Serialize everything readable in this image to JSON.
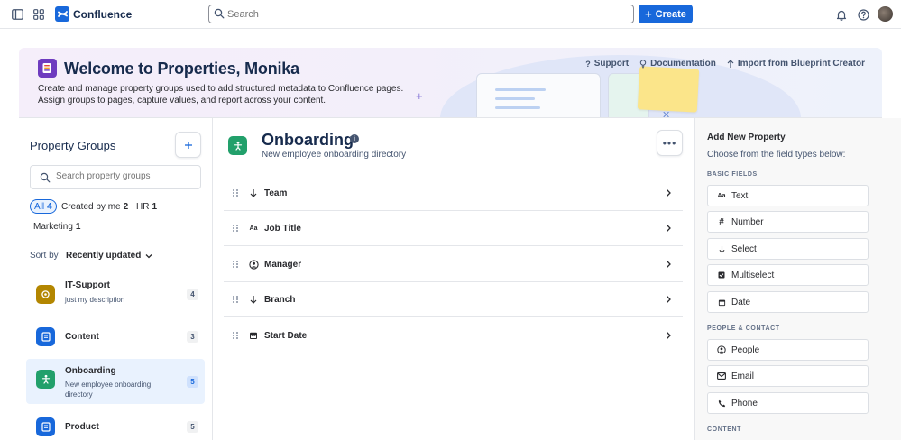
{
  "topbar": {
    "app_name": "Confluence",
    "search_placeholder": "Search",
    "create_label": "Create"
  },
  "banner": {
    "title": "Welcome to Properties, Monika",
    "description_line1": "Create and manage property groups used to add structured metadata to Confluence pages.",
    "description_line2": "Assign groups to pages, capture values, and report across your content.",
    "links": [
      "Support",
      "Documentation",
      "Import from Blueprint Creator"
    ]
  },
  "left": {
    "title": "Property Groups",
    "search_placeholder": "Search property groups",
    "filters": [
      {
        "label": "All",
        "count": "4"
      },
      {
        "label": "Created by me",
        "count": "2"
      },
      {
        "label": "HR",
        "count": "1"
      },
      {
        "label": "Marketing",
        "count": "1"
      }
    ],
    "sort_label": "Sort by",
    "sort_value": "Recently updated",
    "groups": [
      {
        "name": "IT-Support",
        "description": "just my description",
        "count": "4",
        "icon": "gear-icon",
        "color": "#b38600"
      },
      {
        "name": "Content",
        "description": "",
        "count": "3",
        "icon": "document-icon",
        "color": "#1868db"
      },
      {
        "name": "Onboarding",
        "description": "New employee onboarding directory",
        "count": "5",
        "icon": "person-icon",
        "color": "#22a06b"
      },
      {
        "name": "Product",
        "description": "",
        "count": "5",
        "icon": "document-icon",
        "color": "#1868db"
      }
    ]
  },
  "main": {
    "title": "Onboarding",
    "description": "New employee onboarding directory",
    "properties": [
      {
        "name": "Team",
        "icon": "select-arrow-icon"
      },
      {
        "name": "Job Title",
        "icon": "text-icon"
      },
      {
        "name": "Manager",
        "icon": "people-icon"
      },
      {
        "name": "Branch",
        "icon": "select-arrow-icon"
      },
      {
        "name": "Start Date",
        "icon": "calendar-icon"
      }
    ]
  },
  "right": {
    "title": "Add New Property",
    "subtitle": "Choose from the field types below:",
    "sections": {
      "basic": "BASIC FIELDS",
      "people": "PEOPLE & CONTACT",
      "content": "CONTENT"
    },
    "basic_fields": [
      "Text",
      "Number",
      "Select",
      "Multiselect",
      "Date"
    ],
    "people_fields": [
      "People",
      "Email",
      "Phone"
    ],
    "text_icon_glyph": "Aa"
  },
  "colors": {
    "accent": "#1868db",
    "onboarding": "#22a06b",
    "banner_logo": "#6e3bbf"
  }
}
